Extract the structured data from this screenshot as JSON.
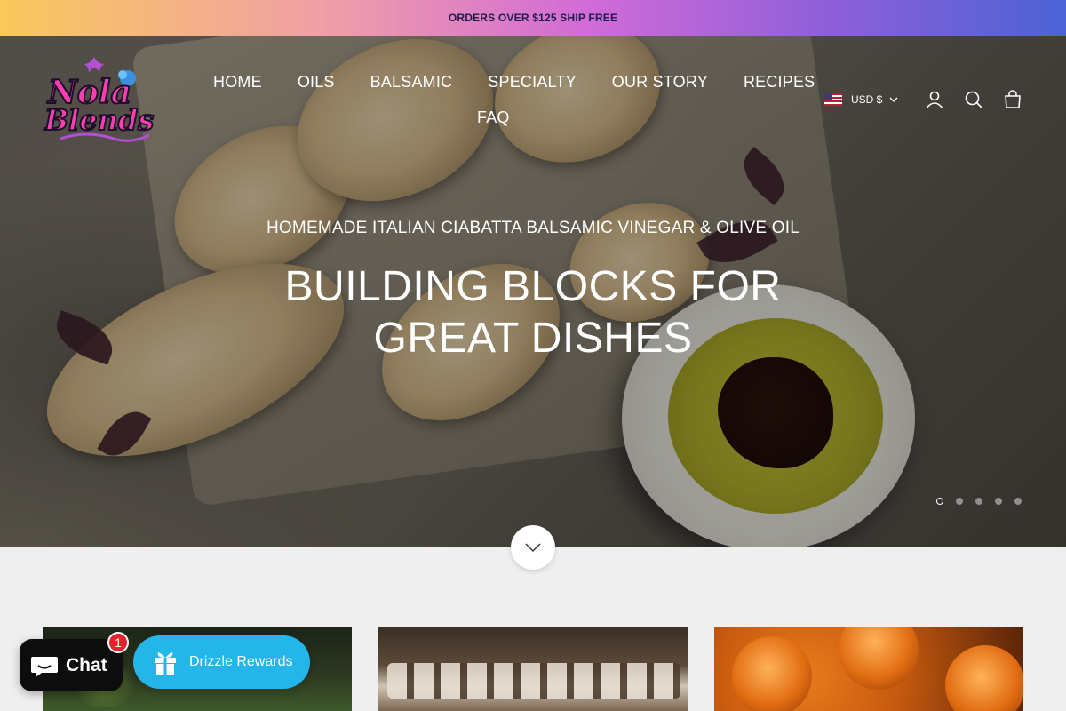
{
  "announcement": {
    "text": "ORDERS OVER $125 SHIP FREE"
  },
  "brand": {
    "name": "Nola Blends"
  },
  "nav": {
    "items": [
      {
        "label": "HOME"
      },
      {
        "label": "OILS"
      },
      {
        "label": "BALSAMIC"
      },
      {
        "label": "SPECIALTY"
      },
      {
        "label": "OUR STORY"
      },
      {
        "label": "RECIPES"
      },
      {
        "label": "FAQ"
      }
    ]
  },
  "header": {
    "currency": "USD $",
    "icons": [
      "account-icon",
      "search-icon",
      "cart-icon"
    ]
  },
  "hero": {
    "subtitle": "HOMEMADE ITALIAN CIABATTA BALSAMIC VINEGAR & OLIVE OIL",
    "title": "BUILDING BLOCKS FOR GREAT DISHES",
    "slide_count": 5,
    "active_slide": 1
  },
  "widgets": {
    "chat_label": "Chat",
    "chat_badge": "1",
    "rewards_label": "Drizzle Rewards"
  },
  "colors": {
    "announcement_gradient": [
      "#f9c95a",
      "#d26bd8",
      "#4b63d6"
    ],
    "rewards": "#24b6e8",
    "chat": "#0d0d0d",
    "badge": "#e5232b"
  }
}
